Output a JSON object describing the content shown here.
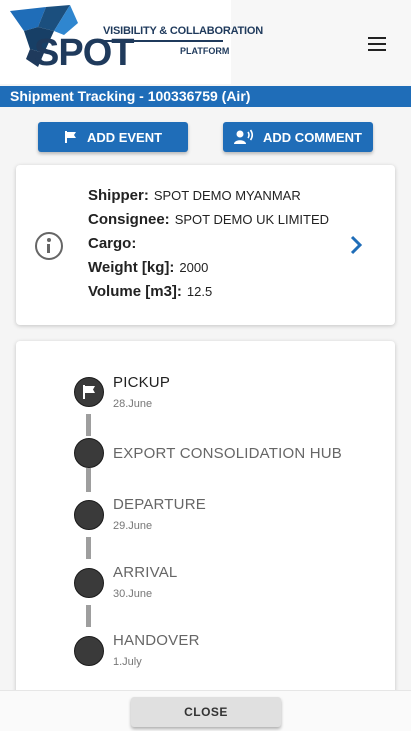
{
  "brand": {
    "logo_word": "SPOT",
    "tagline_line1": "VISIBILITY & COLLABORATION",
    "tagline_line2": "PLATFORM",
    "primary_color": "#1f6db8"
  },
  "header": {
    "menu_icon": "hamburger-menu-icon"
  },
  "page": {
    "title": "Shipment Tracking - 100336759 (Air)"
  },
  "actions": {
    "add_event": "ADD EVENT",
    "add_event_icon": "flag-icon",
    "add_comment": "ADD COMMENT",
    "add_comment_icon": "person-voice-icon"
  },
  "shipment": {
    "rows": [
      {
        "label": "Shipper:",
        "value": "SPOT DEMO MYANMAR"
      },
      {
        "label": "Consignee:",
        "value": "SPOT DEMO UK LIMITED"
      },
      {
        "label": "Cargo:",
        "value": ""
      },
      {
        "label": "Weight [kg]:",
        "value": "2000"
      },
      {
        "label": "Volume [m3]:",
        "value": "12.5"
      }
    ],
    "info_icon": "info-icon",
    "details_icon": "chevron-right-icon"
  },
  "timeline": [
    {
      "name": "PICKUP",
      "date": "28.June",
      "status": "current",
      "icon": "flag-icon"
    },
    {
      "name": "EXPORT CONSOLIDATION HUB",
      "date": "",
      "status": "pending"
    },
    {
      "name": "DEPARTURE",
      "date": "29.June",
      "status": "pending"
    },
    {
      "name": "ARRIVAL",
      "date": "30.June",
      "status": "pending"
    },
    {
      "name": "HANDOVER",
      "date": "1.July",
      "status": "pending"
    }
  ],
  "footer": {
    "close_label": "CLOSE"
  }
}
